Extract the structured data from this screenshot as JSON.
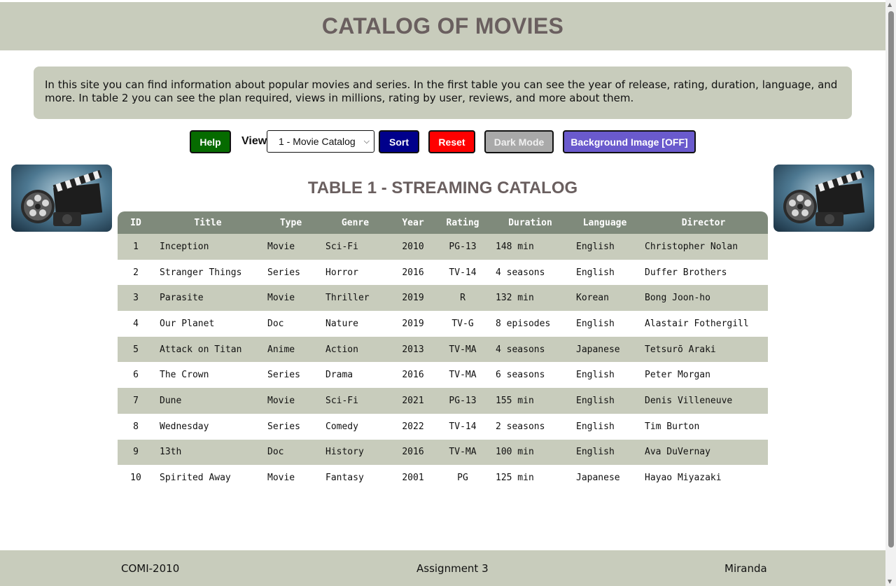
{
  "header": {
    "title": "CATALOG OF MOVIES"
  },
  "intro": {
    "text": "In this site you can find information about popular movies and series. In the first table you can see the year of release, rating, duration, language, and more. In table 2 you can see the plan required, views in millions, rating by user, reviews, and more about them."
  },
  "controls": {
    "help_label": "Help",
    "view_label": "View",
    "view_selected": "1 - Movie Catalog",
    "sort_label": "Sort",
    "reset_label": "Reset",
    "dark_mode_label": "Dark Mode",
    "background_image_label": "Background Image [OFF]"
  },
  "table": {
    "title": "TABLE 1 - STREAMING CATALOG",
    "headers": [
      "ID",
      "Title",
      "Type",
      "Genre",
      "Year",
      "Rating",
      "Duration",
      "Language",
      "Director"
    ],
    "rows": [
      [
        "1",
        "Inception",
        "Movie",
        "Sci-Fi",
        "2010",
        "PG-13",
        "148 min",
        "English",
        "Christopher Nolan"
      ],
      [
        "2",
        "Stranger Things",
        "Series",
        "Horror",
        "2016",
        "TV-14",
        "4 seasons",
        "English",
        "Duffer Brothers"
      ],
      [
        "3",
        "Parasite",
        "Movie",
        "Thriller",
        "2019",
        "R",
        "132 min",
        "Korean",
        "Bong Joon-ho"
      ],
      [
        "4",
        "Our Planet",
        "Doc",
        "Nature",
        "2019",
        "TV-G",
        "8 episodes",
        "English",
        "Alastair Fothergill"
      ],
      [
        "5",
        "Attack on Titan",
        "Anime",
        "Action",
        "2013",
        "TV-MA",
        "4 seasons",
        "Japanese",
        "Tetsurō Araki"
      ],
      [
        "6",
        "The Crown",
        "Series",
        "Drama",
        "2016",
        "TV-MA",
        "6 seasons",
        "English",
        "Peter Morgan"
      ],
      [
        "7",
        "Dune",
        "Movie",
        "Sci-Fi",
        "2021",
        "PG-13",
        "155 min",
        "English",
        "Denis Villeneuve"
      ],
      [
        "8",
        "Wednesday",
        "Series",
        "Comedy",
        "2022",
        "TV-14",
        "2 seasons",
        "English",
        "Tim Burton"
      ],
      [
        "9",
        "13th",
        "Doc",
        "History",
        "2016",
        "TV-MA",
        "100 min",
        "English",
        "Ava DuVernay"
      ],
      [
        "10",
        "Spirited Away",
        "Movie",
        "Fantasy",
        "2001",
        "PG",
        "125 min",
        "Japanese",
        "Hayao Miyazaki"
      ]
    ]
  },
  "footer": {
    "left": "COMI-2010",
    "center": "Assignment 3",
    "right": "Miranda"
  },
  "icons": {
    "side_image": "film-reel-clapperboard-image",
    "select_arrow": "chevron-down-icon"
  },
  "colors": {
    "panel": "#c8ccbc",
    "table_header": "#7f8a7b",
    "title_text": "#6a5f5f",
    "help": "#066b00",
    "sort": "#00008b",
    "reset": "#ff0000",
    "dark_mode": "#a9a9a9",
    "background_image": "#6a5acd"
  }
}
